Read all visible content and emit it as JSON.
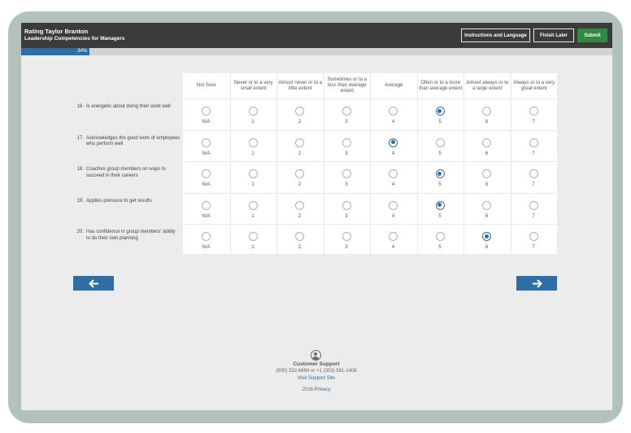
{
  "header": {
    "title": "Rating Taylor Branton",
    "subtitle": "Leadership Competencies for Managers",
    "instructions_label": "Instructions and Language",
    "finish_later_label": "Finish Later",
    "submit_label": "Submit"
  },
  "progress": {
    "label": "34%",
    "value": 34
  },
  "columns": [
    "Not Sure",
    "Never or to a very small extent",
    "Almost never or to a little extent",
    "Sometimes or to a less than average extent",
    "Average",
    "Often or to a more than average extent",
    "Almost always or to a large extent",
    "Always or to a very great extent"
  ],
  "choice_labels": [
    "N/A",
    "1",
    "2",
    "3",
    "4",
    "5",
    "6",
    "7"
  ],
  "questions": [
    {
      "number": "16.",
      "text": "Is energetic about doing their work well",
      "selected": 5
    },
    {
      "number": "17.",
      "text": "Acknowledges the good work of employees who perform well",
      "selected": 4
    },
    {
      "number": "18.",
      "text": "Coaches group members on ways to succeed in their careers",
      "selected": 5
    },
    {
      "number": "19.",
      "text": "Applies pressure to get results",
      "selected": 5
    },
    {
      "number": "20.",
      "text": "Has confidence in group members' ability to do their own planning",
      "selected": 6
    }
  ],
  "nav": {
    "prev_icon": "arrow-left-icon",
    "next_icon": "arrow-right-icon"
  },
  "footer": {
    "support_icon": "person-circle-icon",
    "title": "Customer Support",
    "phone": "(800) 332-6684 or +1 (303) 581-1408",
    "site_link": "Visit Support Site",
    "year": "2016",
    "privacy_link": "Privacy"
  },
  "colors": {
    "accent": "#2f6ea5",
    "submit": "#2e8b3e",
    "header": "#3b3b3b"
  }
}
